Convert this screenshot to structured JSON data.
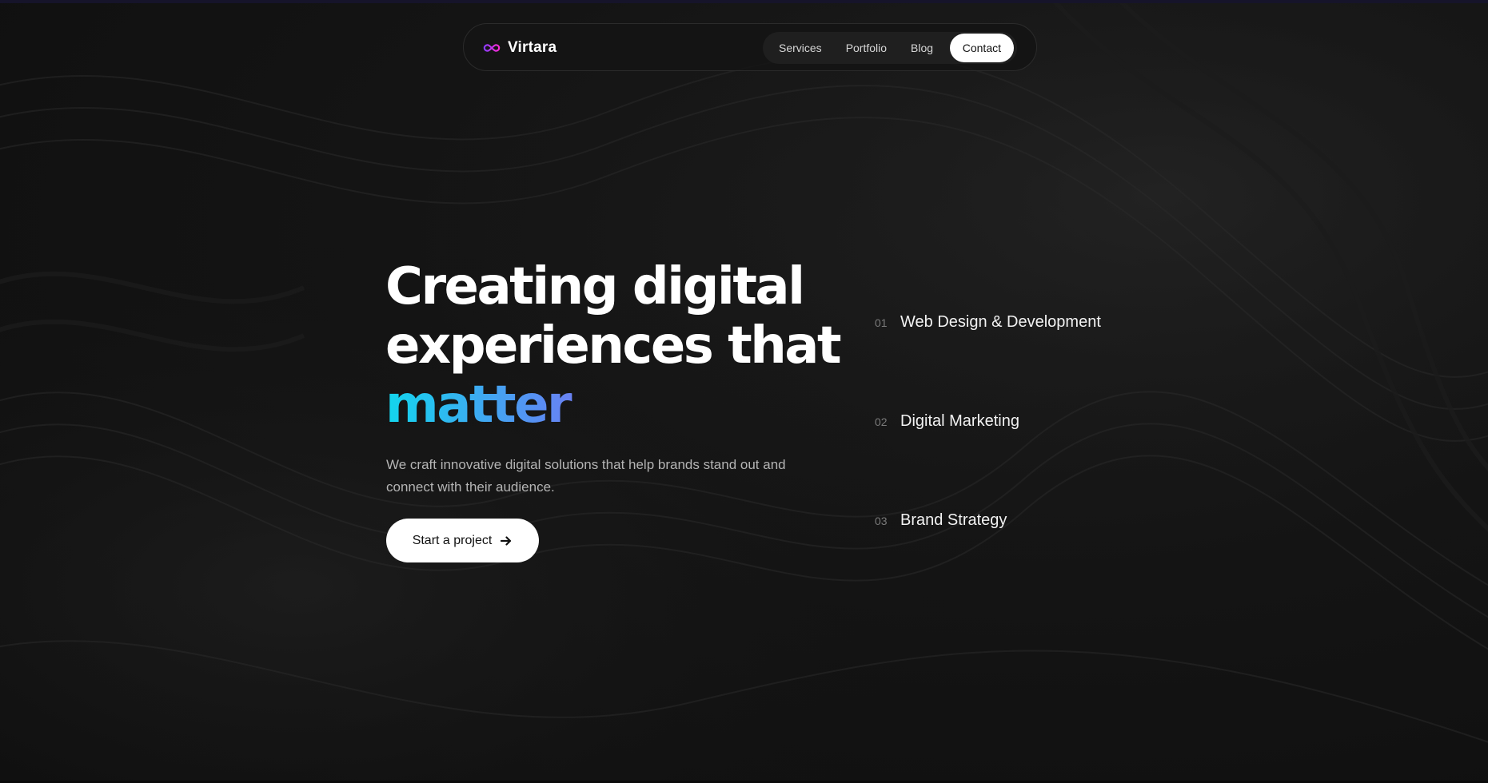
{
  "colors": {
    "background": "#121212",
    "text_primary": "#ffffff",
    "text_secondary": "#b4b4b4",
    "accent_gradient": [
      "#12d6ee",
      "#5b8cf3",
      "#a45cf0",
      "#f01fd6"
    ],
    "button_bg": "#ffffff",
    "button_text": "#111111"
  },
  "header": {
    "brand": {
      "name": "Virtara",
      "icon": "infinity-logo-icon"
    },
    "nav": {
      "items": [
        {
          "label": "Services"
        },
        {
          "label": "Portfolio"
        },
        {
          "label": "Blog"
        }
      ],
      "contact_label": "Contact"
    }
  },
  "hero": {
    "title_line1": "Creating digital",
    "title_line2": "experiences that",
    "title_highlight": "matter",
    "subtitle": "We craft innovative digital solutions that help brands stand out and connect with their audience.",
    "cta_label": "Start a project",
    "cta_icon": "arrow-right-icon"
  },
  "services": [
    {
      "number": "01",
      "name": "Web Design & Development"
    },
    {
      "number": "02",
      "name": "Digital Marketing"
    },
    {
      "number": "03",
      "name": "Brand Strategy"
    }
  ]
}
